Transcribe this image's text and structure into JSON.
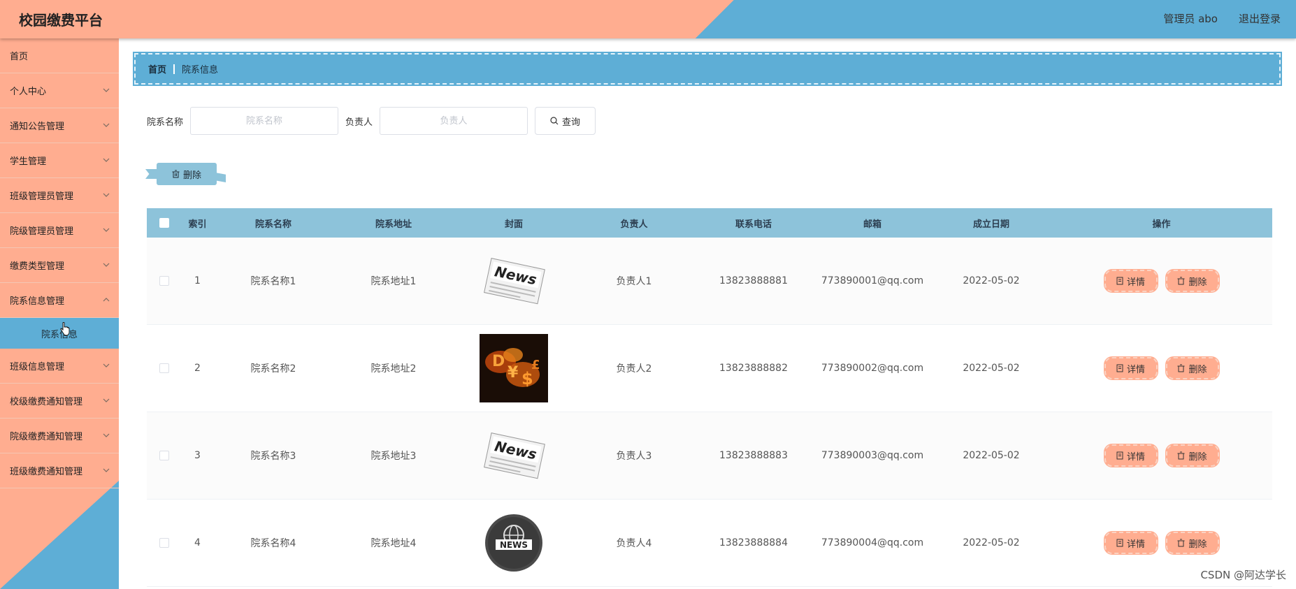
{
  "header": {
    "title": "校园缴费平台",
    "admin_label": "管理员 abo",
    "logout_label": "退出登录"
  },
  "sidebar": {
    "items": [
      {
        "label": "首页",
        "has_children": false
      },
      {
        "label": "个人中心",
        "has_children": true
      },
      {
        "label": "通知公告管理",
        "has_children": true
      },
      {
        "label": "学生管理",
        "has_children": true
      },
      {
        "label": "班级管理员管理",
        "has_children": true
      },
      {
        "label": "院级管理员管理",
        "has_children": true
      },
      {
        "label": "缴费类型管理",
        "has_children": true
      },
      {
        "label": "院系信息管理",
        "has_children": true
      }
    ],
    "active_sub_item": "院系信息",
    "items_after": [
      {
        "label": "班级信息管理",
        "has_children": true
      },
      {
        "label": "校级缴费通知管理",
        "has_children": true
      },
      {
        "label": "院级缴费通知管理",
        "has_children": true
      },
      {
        "label": "班级缴费通知管理",
        "has_children": true
      }
    ]
  },
  "breadcrumb": {
    "home": "首页",
    "current": "院系信息"
  },
  "search": {
    "name_label": "院系名称",
    "name_placeholder": "院系名称",
    "owner_label": "负责人",
    "owner_placeholder": "负责人",
    "button_label": "查询"
  },
  "toolbar": {
    "delete_label": "删除"
  },
  "table": {
    "headers": {
      "index": "索引",
      "name": "院系名称",
      "address": "院系地址",
      "cover": "封面",
      "owner": "负责人",
      "phone": "联系电话",
      "email": "邮箱",
      "date": "成立日期",
      "ops": "操作"
    },
    "rows": [
      {
        "index": "1",
        "name": "院系名称1",
        "address": "院系地址1",
        "cover": "news-paper-image",
        "owner": "负责人1",
        "phone": "13823888881",
        "email": "773890001@qq.com",
        "date": "2022-05-02",
        "detail": "详情",
        "delete": "删除"
      },
      {
        "index": "2",
        "name": "院系名称2",
        "address": "院系地址2",
        "cover": "money-fire-image",
        "owner": "负责人2",
        "phone": "13823888882",
        "email": "773890002@qq.com",
        "date": "2022-05-02",
        "detail": "详情",
        "delete": "删除"
      },
      {
        "index": "3",
        "name": "院系名称3",
        "address": "院系地址3",
        "cover": "news-paper-image",
        "owner": "负责人3",
        "phone": "13823888883",
        "email": "773890003@qq.com",
        "date": "2022-05-02",
        "detail": "详情",
        "delete": "删除"
      },
      {
        "index": "4",
        "name": "院系名称4",
        "address": "院系地址4",
        "cover": "news-globe-image",
        "owner": "负责人4",
        "phone": "13823888884",
        "email": "773890004@qq.com",
        "date": "2022-05-02",
        "detail": "详情",
        "delete": "删除"
      }
    ]
  },
  "watermark": "CSDN @阿达学长",
  "colors": {
    "peach": "#ffad90",
    "blue": "#5eaed6",
    "table_header": "#8dc3da"
  }
}
